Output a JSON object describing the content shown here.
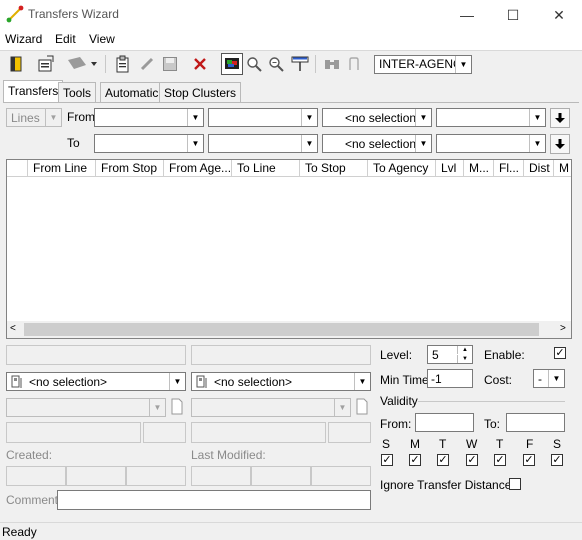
{
  "window": {
    "title": "Transfers Wizard"
  },
  "window_controls": {
    "minimize": "—",
    "maximize": "☐",
    "close": "✕"
  },
  "menu": [
    "Wizard",
    "Edit",
    "View"
  ],
  "toolbar": {
    "agency_select": "INTER-AGENCY"
  },
  "tabs": [
    "Transfers",
    "Tools",
    "Automatic",
    "Stop Clusters"
  ],
  "filters": {
    "mode_select": "Lines",
    "from_label": "From",
    "to_label": "To",
    "from_agency": "<no selection>",
    "to_agency": "<no selection>"
  },
  "grid": {
    "columns": [
      "From Line",
      "From Stop",
      "From Age...",
      "To Line",
      "To Stop",
      "To Agency",
      "Lvl",
      "M...",
      "Fl...",
      "Dist",
      "M"
    ]
  },
  "detail": {
    "from_selection": "<no selection>",
    "to_selection": "<no selection>",
    "created_label": "Created:",
    "last_modified_label": "Last Modified:",
    "comment_label": "Comment:"
  },
  "properties": {
    "level_label": "Level:",
    "level_value": "5",
    "enable_label": "Enable:",
    "enable_checked": true,
    "min_time_label": "Min Time:",
    "min_time_value": "-1",
    "cost_label": "Cost:",
    "cost_value": "-",
    "validity_label": "Validity",
    "validity_from_label": "From:",
    "validity_to_label": "To:",
    "days": [
      "S",
      "M",
      "T",
      "W",
      "T",
      "F",
      "S"
    ],
    "ignore_distance_label": "Ignore Transfer Distance:"
  },
  "status": "Ready"
}
